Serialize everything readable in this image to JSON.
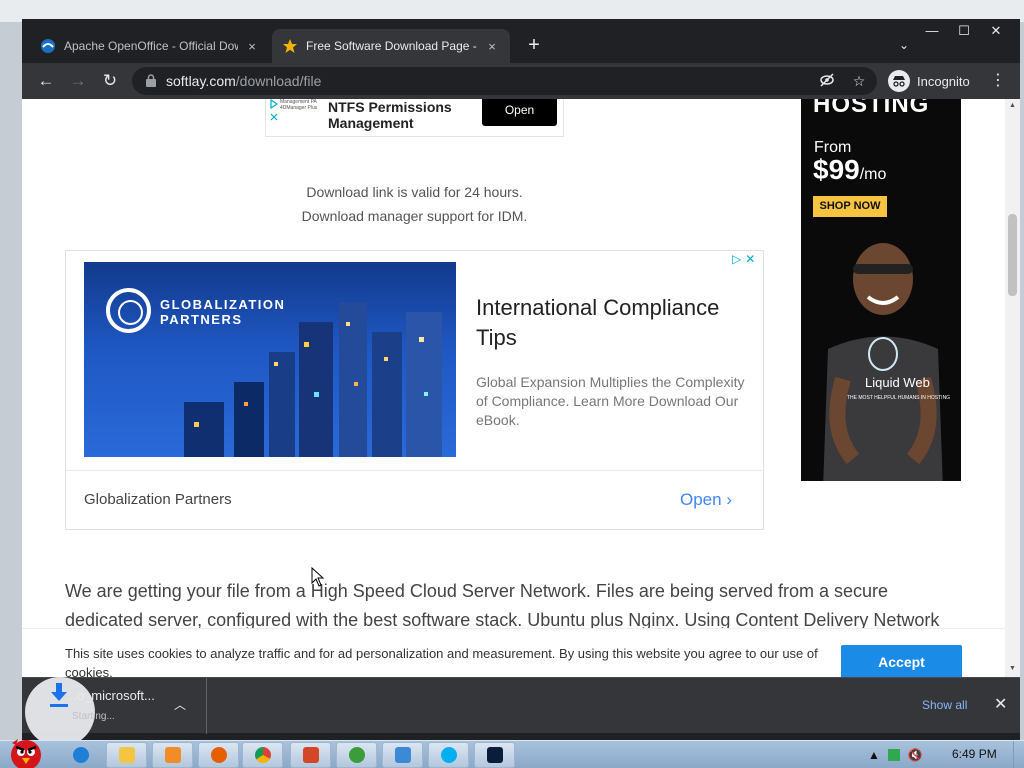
{
  "tabs": [
    {
      "title": "Apache OpenOffice - Official Dow",
      "close": "×"
    },
    {
      "title": "Free Software Download Page - S",
      "close": "×"
    }
  ],
  "toolbar": {
    "url_host": "softlay.com",
    "url_path": "/download/file",
    "incognito_label": "Incognito"
  },
  "window_controls": {
    "minimize": "—",
    "maximize": "☐",
    "close": "✕"
  },
  "ads": {
    "top": {
      "thumb_text": "Management PA 4DManager Plus",
      "title": "NTFS Permissions Management",
      "cta": "Open"
    },
    "main": {
      "brand": "GLOBALIZATION PARTNERS",
      "heading": "International Compliance Tips",
      "description": "Global Expansion Multiplies the Complexity of Compliance. Learn More Download Our eBook.",
      "advertiser": "Globalization Partners",
      "cta": "Open",
      "chevron": "›"
    },
    "side": {
      "headline": "HOSTING",
      "from": "From",
      "price": "$99",
      "per": "/mo",
      "cta": "SHOP NOW",
      "brand": "Liquid Web",
      "tagline": "THE MOST HELPFUL HUMANS IN HOSTING"
    }
  },
  "download_info": {
    "line1": "Download link is valid for 24 hours.",
    "line2": "Download manager support for IDM."
  },
  "body_text": "We are getting your file from a High Speed Cloud Server Network. Files are being served from a secure dedicated server, configured with the best software stack. Ubuntu plus Nginx. Using Content Delivery Network",
  "cookie": {
    "text": "This site uses cookies to analyze traffic and for ad personalization and measurement. By using this website you agree to our use of cookies.",
    "accept": "Accept"
  },
  "download_bar": {
    "file_name": "...o_microsoft...",
    "status": "Starting...",
    "show_all": "Show all"
  },
  "taskbar": {
    "clock": "6:49 PM"
  },
  "colors": {
    "accent_blue": "#1a8be6",
    "link_blue": "#4285f4",
    "chrome_dark": "#202124"
  }
}
